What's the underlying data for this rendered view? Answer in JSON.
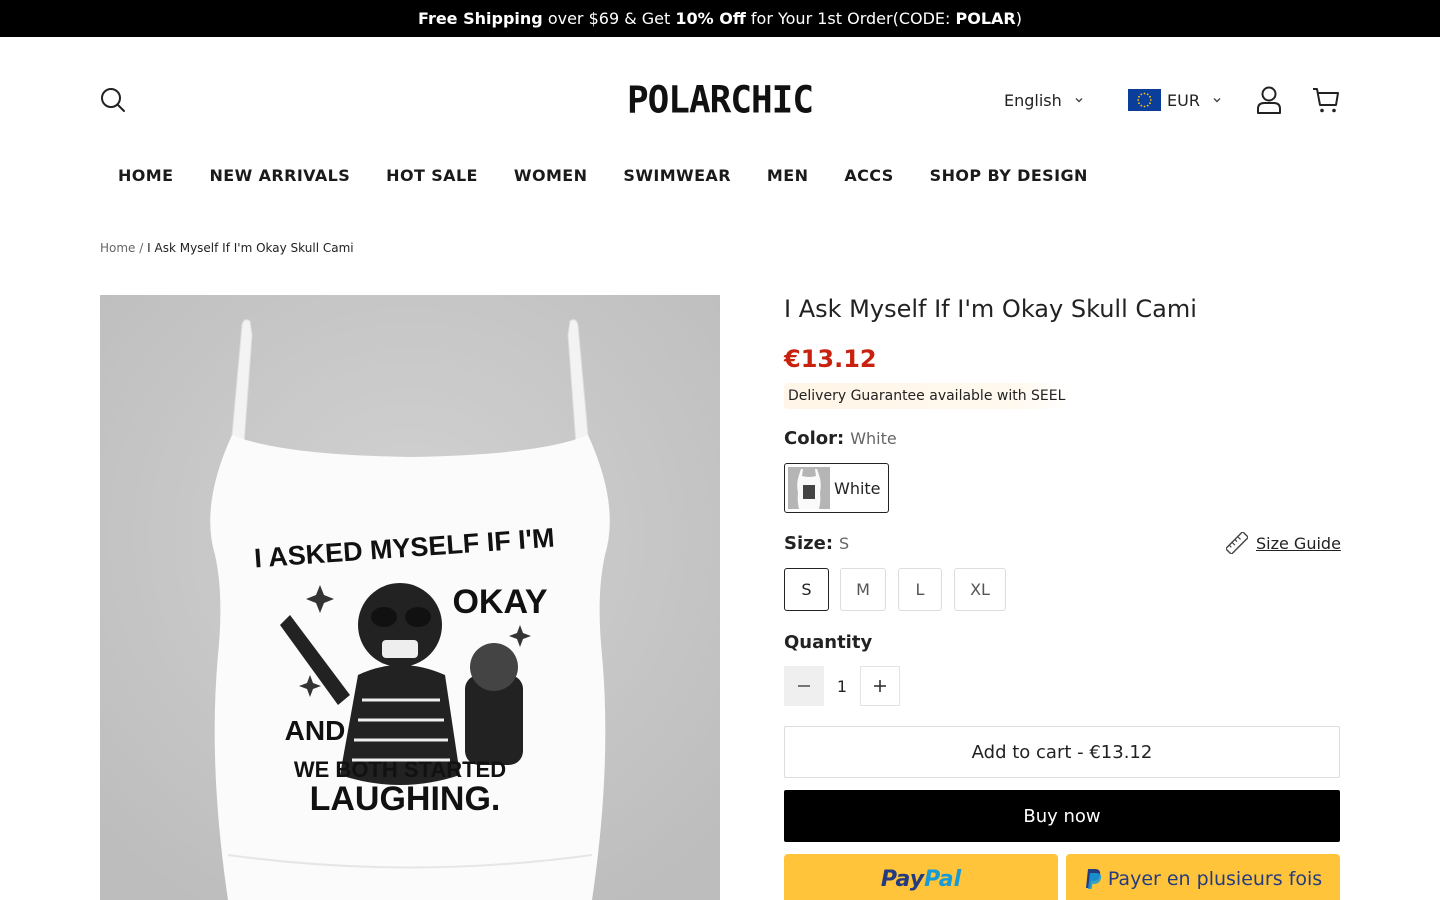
{
  "announcement": {
    "part1": "Free Shipping",
    "part2": " over $69 & Get ",
    "part3": "10% Off",
    "part4": " for Your 1st Order(CODE: ",
    "part5": "POLAR",
    "part6": ")"
  },
  "header": {
    "logo": "POLARCHIC",
    "language": "English",
    "currency": "EUR",
    "icons": [
      "search-icon",
      "account-icon",
      "cart-icon"
    ]
  },
  "nav": {
    "items": [
      "HOME",
      "NEW ARRIVALS",
      "HOT SALE",
      "WOMEN",
      "SWIMWEAR",
      "MEN",
      "ACCS",
      "SHOP BY DESIGN"
    ]
  },
  "breadcrumb": {
    "home": "Home",
    "separator": "/",
    "current": "I Ask Myself If I'm Okay Skull Cami"
  },
  "product": {
    "title": "I Ask Myself If I'm Okay Skull Cami",
    "price": "€13.12",
    "price_color": "#c8220e",
    "seel_text": "Delivery Guarantee available with SEEL",
    "color_label": "Color:",
    "color_value": "White",
    "color_options": [
      "White"
    ],
    "size_label": "Size:",
    "size_value": "S",
    "size_guide": "Size Guide",
    "sizes": [
      "S",
      "M",
      "L",
      "XL"
    ],
    "quantity_label": "Quantity",
    "quantity": "1",
    "add_to_cart": "Add to cart - €13.12",
    "buy_now": "Buy now",
    "paypal_pay": "Pay",
    "paypal_pal": "Pal",
    "paypal_later": "Payer en plusieurs fois",
    "image_text": {
      "line1": "I ASKED MYSELF IF I'M",
      "line2": "OKAY",
      "line3": "AND",
      "line4": "WE BOTH STARTED",
      "line5": "LAUGHING."
    }
  }
}
